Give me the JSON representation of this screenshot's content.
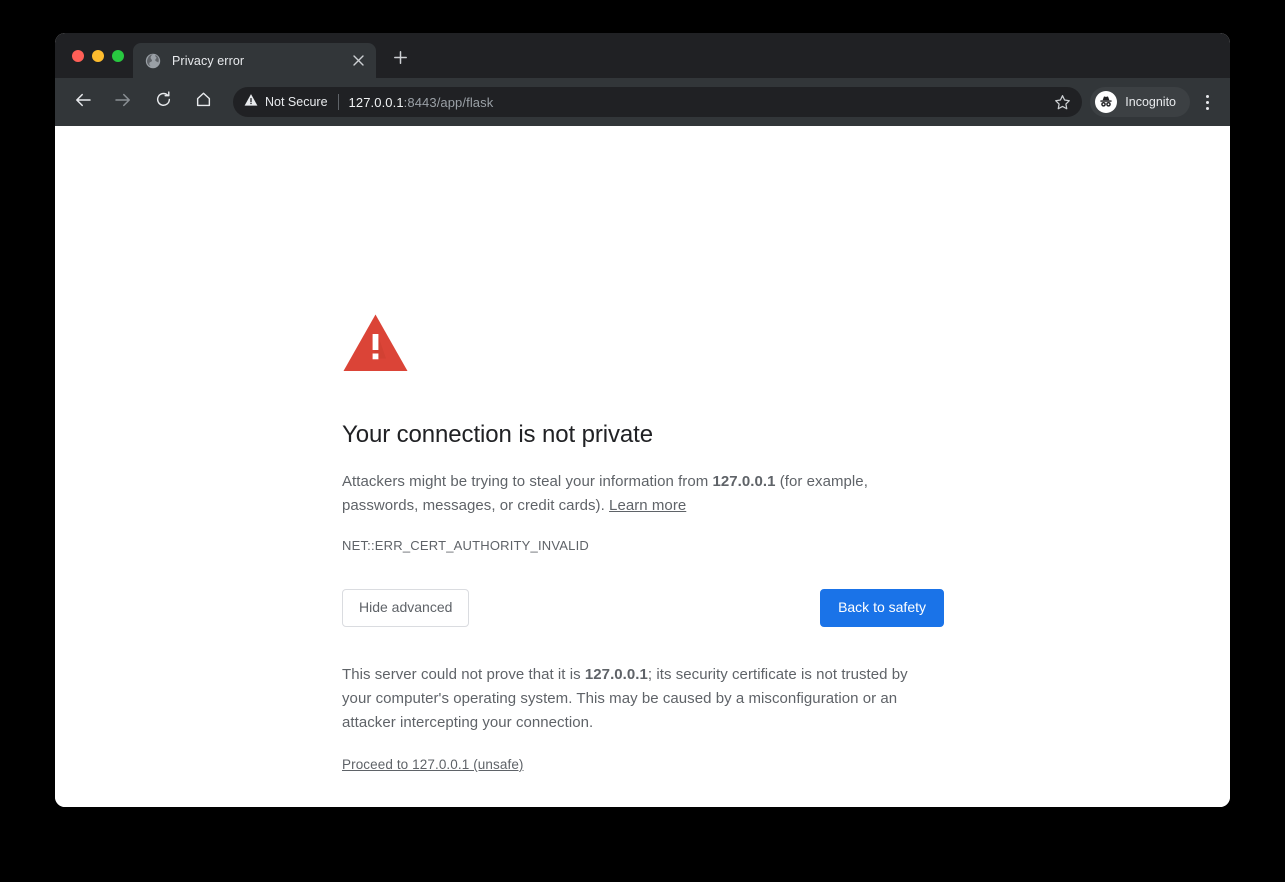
{
  "window": {
    "traffic_lights": [
      {
        "name": "close",
        "color": "#ff5f57"
      },
      {
        "name": "minimize",
        "color": "#febc2e"
      },
      {
        "name": "maximize",
        "color": "#28c840"
      }
    ]
  },
  "tabstrip": {
    "tab": {
      "title": "Privacy error",
      "favicon": "globe-icon",
      "close_icon": "close-icon"
    },
    "new_tab_icon": "plus-icon"
  },
  "toolbar": {
    "back_icon": "arrow-left-icon",
    "forward_icon": "arrow-right-icon",
    "reload_icon": "reload-icon",
    "home_icon": "home-icon",
    "security": {
      "icon": "warning-triangle-icon",
      "label": "Not Secure"
    },
    "url": {
      "host": "127.0.0.1",
      "rest": ":8443/app/flask",
      "full": "127.0.0.1:8443/app/flask"
    },
    "bookmark_icon": "star-icon",
    "profile": {
      "avatar_icon": "incognito-icon",
      "label": "Incognito"
    },
    "menu_icon": "three-dot-menu-icon"
  },
  "interstitial": {
    "icon": "red-warning-triangle-icon",
    "headline": "Your connection is not private",
    "paragraph": {
      "before_host": "Attackers might be trying to steal your information from ",
      "host": "127.0.0.1",
      "after_host": " (for example, passwords, messages, or credit cards). ",
      "learn_more": "Learn more"
    },
    "error_code": "NET::ERR_CERT_AUTHORITY_INVALID",
    "buttons": {
      "advanced": "Hide advanced",
      "back_to_safety": "Back to safety"
    },
    "advanced": {
      "before_host": "This server could not prove that it is ",
      "host": "127.0.0.1",
      "after_host": "; its security certificate is not trusted by your computer's operating system. This may be caused by a misconfiguration or an attacker intercepting your connection.",
      "proceed_link": "Proceed to 127.0.0.1 (unsafe)"
    }
  },
  "colors": {
    "accent_blue": "#1a73e8",
    "warning_red": "#db4437",
    "chrome_dark": "#323639",
    "tabstrip_dark": "#202124",
    "text_primary": "#202124",
    "text_secondary": "#5f6368"
  }
}
